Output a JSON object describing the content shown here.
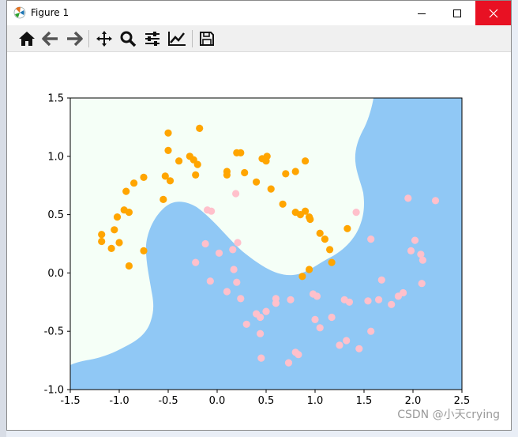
{
  "window": {
    "title": "Figure 1",
    "icons": [
      "matplotlib-logo-icon",
      "minimize-icon",
      "maximize-icon",
      "close-icon"
    ]
  },
  "toolbar": {
    "buttons": [
      {
        "name": "home",
        "icon": "home-icon"
      },
      {
        "name": "back",
        "icon": "arrow-left-icon"
      },
      {
        "name": "forward",
        "icon": "arrow-right-icon"
      },
      {
        "name": "pan",
        "icon": "move-icon"
      },
      {
        "name": "zoom",
        "icon": "magnifier-icon"
      },
      {
        "name": "configure-subplots",
        "icon": "sliders-icon"
      },
      {
        "name": "edit-axis",
        "icon": "line-chart-icon"
      },
      {
        "name": "save",
        "icon": "floppy-disk-icon"
      }
    ]
  },
  "watermark": "CSDN @小天crying",
  "chart_data": {
    "type": "scatter",
    "title": "",
    "xlabel": "",
    "ylabel": "",
    "xlim": [
      -1.5,
      2.5
    ],
    "ylim": [
      -1.0,
      1.5
    ],
    "xticks": [
      "-1.5",
      "-1.0",
      "-0.5",
      "0.0",
      "0.5",
      "1.0",
      "1.5",
      "2.0",
      "2.5"
    ],
    "yticks": [
      "-1.0",
      "-0.5",
      "0.0",
      "0.5",
      "1.0",
      "1.5"
    ],
    "grid": false,
    "legend": "none",
    "decision_regions": [
      {
        "label": "class 0 region",
        "color": "#f5fff7"
      },
      {
        "label": "class 1 region",
        "color": "#90c8f5"
      }
    ],
    "series": [
      {
        "color": "#ffa500",
        "points": [
          [
            -1.18,
            0.33
          ],
          [
            -1.18,
            0.27
          ],
          [
            -1.08,
            0.21
          ],
          [
            -1.05,
            0.37
          ],
          [
            -1.02,
            0.48
          ],
          [
            -1.0,
            0.26
          ],
          [
            -0.95,
            0.54
          ],
          [
            -0.93,
            0.7
          ],
          [
            -0.9,
            0.52
          ],
          [
            -0.9,
            0.06
          ],
          [
            -0.85,
            0.77
          ],
          [
            -0.75,
            0.82
          ],
          [
            -0.75,
            0.19
          ],
          [
            -0.55,
            0.63
          ],
          [
            -0.53,
            0.83
          ],
          [
            -0.5,
            1.05
          ],
          [
            -0.5,
            1.2
          ],
          [
            -0.48,
            0.79
          ],
          [
            -0.39,
            0.96
          ],
          [
            -0.28,
            1.0
          ],
          [
            -0.24,
            0.97
          ],
          [
            -0.22,
            0.84
          ],
          [
            -0.2,
            0.93
          ],
          [
            -0.18,
            1.24
          ],
          [
            0.1,
            0.87
          ],
          [
            0.1,
            0.84
          ],
          [
            0.2,
            1.03
          ],
          [
            0.24,
            1.03
          ],
          [
            0.28,
            0.86
          ],
          [
            0.4,
            0.78
          ],
          [
            0.46,
            0.98
          ],
          [
            0.5,
            0.96
          ],
          [
            0.51,
            1.0
          ],
          [
            0.55,
            0.72
          ],
          [
            0.67,
            0.59
          ],
          [
            0.7,
            0.85
          ],
          [
            0.8,
            0.87
          ],
          [
            0.8,
            0.52
          ],
          [
            0.85,
            0.5
          ],
          [
            0.9,
            0.96
          ],
          [
            0.9,
            0.53
          ],
          [
            0.94,
            0.48
          ],
          [
            0.95,
            0.46
          ],
          [
            0.87,
            -0.03
          ],
          [
            0.94,
            0.03
          ],
          [
            1.05,
            0.34
          ],
          [
            1.1,
            0.29
          ],
          [
            1.15,
            0.2
          ],
          [
            1.17,
            0.09
          ],
          [
            1.33,
            0.38
          ]
        ]
      },
      {
        "color": "#ffc0cb",
        "points": [
          [
            -0.22,
            0.09
          ],
          [
            -0.12,
            0.25
          ],
          [
            -0.1,
            0.54
          ],
          [
            -0.07,
            -0.07
          ],
          [
            -0.06,
            0.53
          ],
          [
            0.02,
            0.17
          ],
          [
            0.1,
            -0.16
          ],
          [
            0.16,
            0.2
          ],
          [
            0.17,
            0.03
          ],
          [
            0.19,
            0.68
          ],
          [
            0.21,
            0.26
          ],
          [
            0.2,
            -0.08
          ],
          [
            0.24,
            -0.22
          ],
          [
            0.3,
            -0.44
          ],
          [
            0.4,
            -0.35
          ],
          [
            0.44,
            -0.38
          ],
          [
            0.44,
            -0.52
          ],
          [
            0.45,
            -0.73
          ],
          [
            0.5,
            -0.33
          ],
          [
            0.6,
            -0.22
          ],
          [
            0.6,
            -0.26
          ],
          [
            0.73,
            -0.77
          ],
          [
            0.75,
            -0.23
          ],
          [
            0.8,
            -0.68
          ],
          [
            0.83,
            -0.7
          ],
          [
            0.98,
            -0.18
          ],
          [
            1.0,
            -0.4
          ],
          [
            1.02,
            -0.2
          ],
          [
            1.05,
            -0.47
          ],
          [
            1.17,
            -0.38
          ],
          [
            1.25,
            -0.62
          ],
          [
            1.3,
            -0.23
          ],
          [
            1.32,
            -0.58
          ],
          [
            1.35,
            -0.25
          ],
          [
            1.42,
            0.52
          ],
          [
            1.45,
            -0.65
          ],
          [
            1.54,
            -0.24
          ],
          [
            1.57,
            0.29
          ],
          [
            1.57,
            -0.5
          ],
          [
            1.65,
            -0.23
          ],
          [
            1.68,
            -0.06
          ],
          [
            1.78,
            -0.27
          ],
          [
            1.85,
            -0.2
          ],
          [
            1.9,
            -0.17
          ],
          [
            1.95,
            0.64
          ],
          [
            1.98,
            0.19
          ],
          [
            2.02,
            0.28
          ],
          [
            2.08,
            0.16
          ],
          [
            2.09,
            -0.09
          ],
          [
            2.1,
            0.11
          ],
          [
            2.23,
            0.62
          ]
        ]
      }
    ]
  }
}
